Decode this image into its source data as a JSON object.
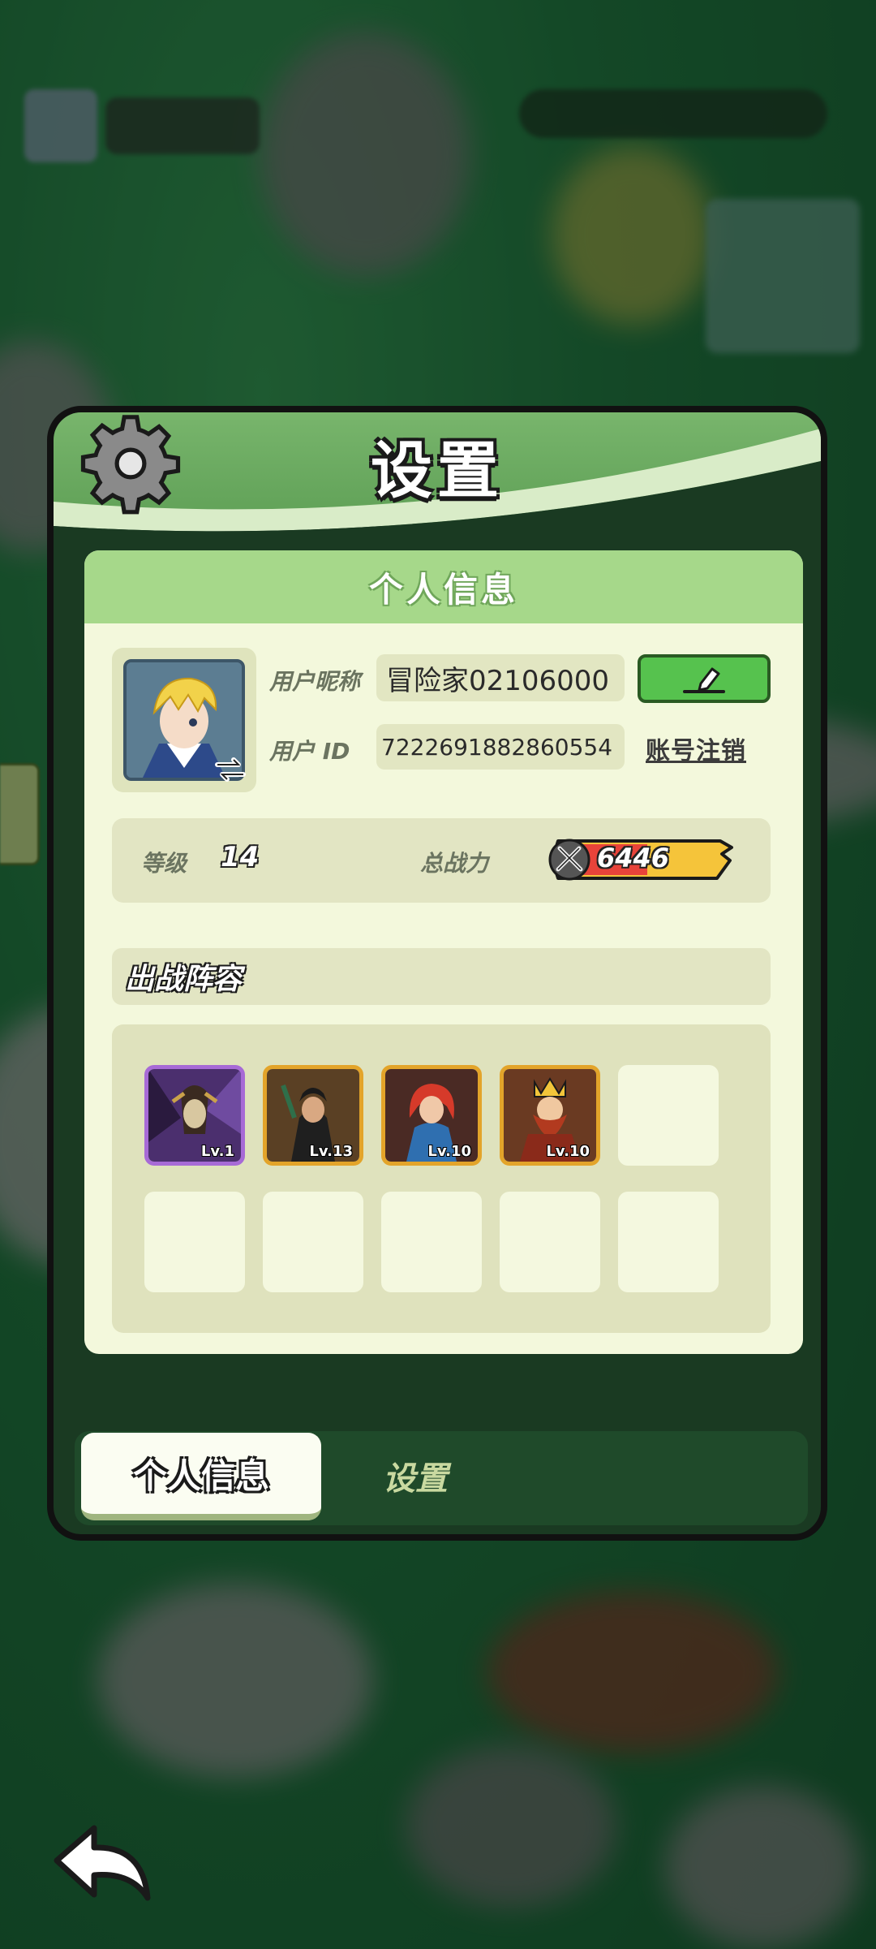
{
  "panel": {
    "title": "设置",
    "section_title": "个人信息",
    "nickname_label": "用户昵称",
    "nickname_value": "冒险家02106000",
    "id_label": "用户 ID",
    "id_value": "7222691882860554",
    "account_cancel": "账号注销",
    "level_label": "等级",
    "level_value": "14",
    "power_label": "总战力",
    "power_value": "6446",
    "lineup_title": "出战阵容",
    "heroes": [
      {
        "level": "Lv.1",
        "rarity": "purple"
      },
      {
        "level": "Lv.13",
        "rarity": "gold"
      },
      {
        "level": "Lv.10",
        "rarity": "gold"
      },
      {
        "level": "Lv.10",
        "rarity": "gold"
      }
    ]
  },
  "tabs": [
    {
      "label": "个人信息",
      "active": true
    },
    {
      "label": "设置",
      "active": false
    }
  ],
  "icons": [
    "gear-icon",
    "swap-avatar-icon",
    "edit-pencil-icon",
    "sword-power-icon",
    "back-arrow-icon"
  ],
  "colors": {
    "panel_green": "#5fa056",
    "card_bg": "#f3f8dc",
    "edit_button": "#56c24e",
    "power_bar": "#f5c43a"
  }
}
